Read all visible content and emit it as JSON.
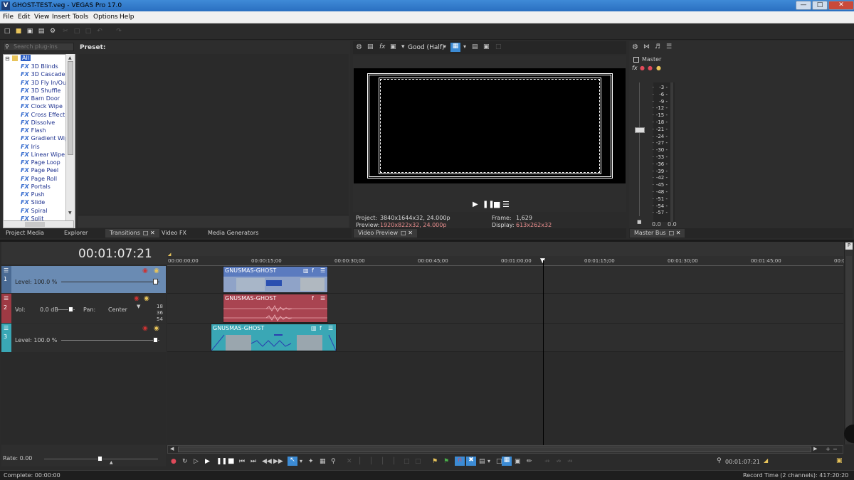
{
  "window": {
    "title": "GHOST-TEST.veg - VEGAS Pro 17.0",
    "app_icon": "V"
  },
  "menu": [
    "File",
    "Edit",
    "View",
    "Insert",
    "Tools",
    "Options",
    "Help"
  ],
  "plugin_panel": {
    "search_placeholder": "Search plug-ins",
    "preset_label": "Preset:",
    "root": "All",
    "items": [
      "3D Blinds",
      "3D Cascade",
      "3D Fly In/Out",
      "3D Shuffle",
      "Barn Door",
      "Clock Wipe",
      "Cross Effect",
      "Dissolve",
      "Flash",
      "Gradient Wipe",
      "Iris",
      "Linear Wipe",
      "Page Loop",
      "Page Peel",
      "Page Roll",
      "Portals",
      "Push",
      "Slide",
      "Spiral",
      "Split"
    ],
    "fx_badge": "FX"
  },
  "left_tabs": [
    "Project Media",
    "Explorer",
    "Transitions",
    "Video FX",
    "Media Generators"
  ],
  "video_preview": {
    "quality": "Good (Half)",
    "tab": "Video Preview",
    "project_label": "Project:",
    "project_value": "3840x1644x32, 24.000p",
    "preview_label": "Preview:",
    "preview_value": "1920x822x32, 24.000p",
    "frame_label": "Frame:",
    "frame_value": "1,629",
    "display_label": "Display:",
    "display_value": "613x262x32"
  },
  "master_bus": {
    "label": "Master",
    "tab": "Master Bus",
    "scale": [
      "3",
      "6",
      "9",
      "12",
      "15",
      "18",
      "21",
      "24",
      "27",
      "30",
      "33",
      "36",
      "39",
      "42",
      "45",
      "48",
      "51",
      "54",
      "57"
    ],
    "left_value": "0.0",
    "right_value": "0.0"
  },
  "timeline": {
    "timecode": "00:01:07:21",
    "ruler": [
      "00:00:00;00",
      "00:00:15;00",
      "00:00:30;00",
      "00:00:45;00",
      "00:01:00;00",
      "00:01:15;00",
      "00:01:30;00",
      "00:01:45;00",
      "00:0"
    ],
    "tracks": [
      {
        "num": "1",
        "label": "Level: 100.0 %"
      },
      {
        "num": "2",
        "vol_label": "Vol:",
        "vol_value": "0.0 dB",
        "pan_label": "Pan:",
        "pan_value": "Center",
        "meter": [
          "18",
          "36",
          "54"
        ]
      },
      {
        "num": "3",
        "label": "Level: 100.0 %"
      }
    ],
    "events": [
      {
        "name": "GNUSMAS-GHOST",
        "type": "video"
      },
      {
        "name": "GNUSMAS-GHOST",
        "type": "audio"
      },
      {
        "name": "GNUSMAS-GHOST",
        "type": "video"
      }
    ]
  },
  "bottom": {
    "rate": "Rate: 0.00",
    "cursor_time": "00:01:07:21",
    "status_left": "Complete: 00:00:00",
    "status_right": "Record Time (2 channels): 417:20:20"
  },
  "colors": {
    "track1": "#6a8bb3",
    "track2": "#9e3a44",
    "track3": "#3aa7b5",
    "event_video": "#5b7bbf",
    "event_audio": "#a94451",
    "event_teal": "#3aa7b5"
  }
}
